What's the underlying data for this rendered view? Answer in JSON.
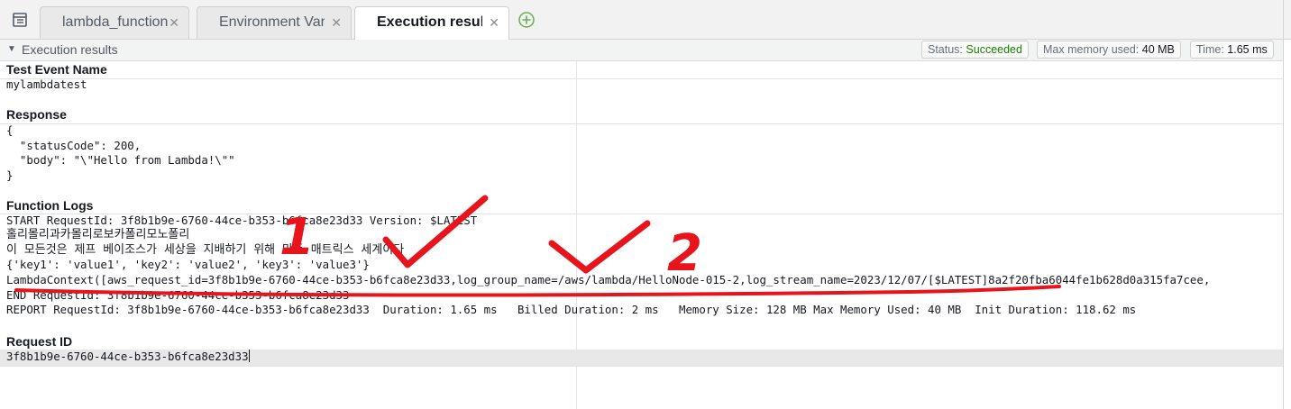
{
  "tabs": [
    {
      "label": "lambda_function"
    },
    {
      "label": "Environment Vari"
    },
    {
      "label": "Execution results"
    }
  ],
  "results": {
    "header_title": "Execution results",
    "status_label": "Status:",
    "status_value": "Succeeded",
    "memory_label": "Max memory used:",
    "memory_value": "40 MB",
    "time_label": "Time:",
    "time_value": "1.65 ms"
  },
  "test_event": {
    "title": "Test Event Name",
    "value": "mylambdatest"
  },
  "response": {
    "title": "Response",
    "lines": [
      "{",
      "  \"statusCode\": 200,",
      "  \"body\": \"\\\"Hello from Lambda!\\\"\"",
      "}"
    ]
  },
  "function_logs": {
    "title": "Function Logs",
    "lines": [
      "START RequestId: 3f8b1b9e-6760-44ce-b353-b6fca8e23d33 Version: $LATEST",
      "홀리몰리과카몰리로보카폴리모노폴리",
      "이 모든것은 제프 베이조스가 세상을 지배하기 위해 만든 매트릭스 세계이다",
      "{'key1': 'value1', 'key2': 'value2', 'key3': 'value3'}",
      "LambdaContext([aws_request_id=3f8b1b9e-6760-44ce-b353-b6fca8e23d33,log_group_name=/aws/lambda/HelloNode-015-2,log_stream_name=2023/12/07/[$LATEST]8a2f20fba6044fe1b628d0a315fa7cee,",
      "END RequestId: 3f8b1b9e-6760-44ce-b353-b6fca8e23d33",
      "REPORT RequestId: 3f8b1b9e-6760-44ce-b353-b6fca8e23d33  Duration: 1.65 ms   Billed Duration: 2 ms   Memory Size: 128 MB Max Memory Used: 40 MB  Init Duration: 118.62 ms"
    ]
  },
  "request_id": {
    "title": "Request ID",
    "value": "3f8b1b9e-6760-44ce-b353-b6fca8e23d33"
  },
  "annotations": {
    "number_1": "1",
    "number_2": "2",
    "ink_color": "#e8141b"
  }
}
